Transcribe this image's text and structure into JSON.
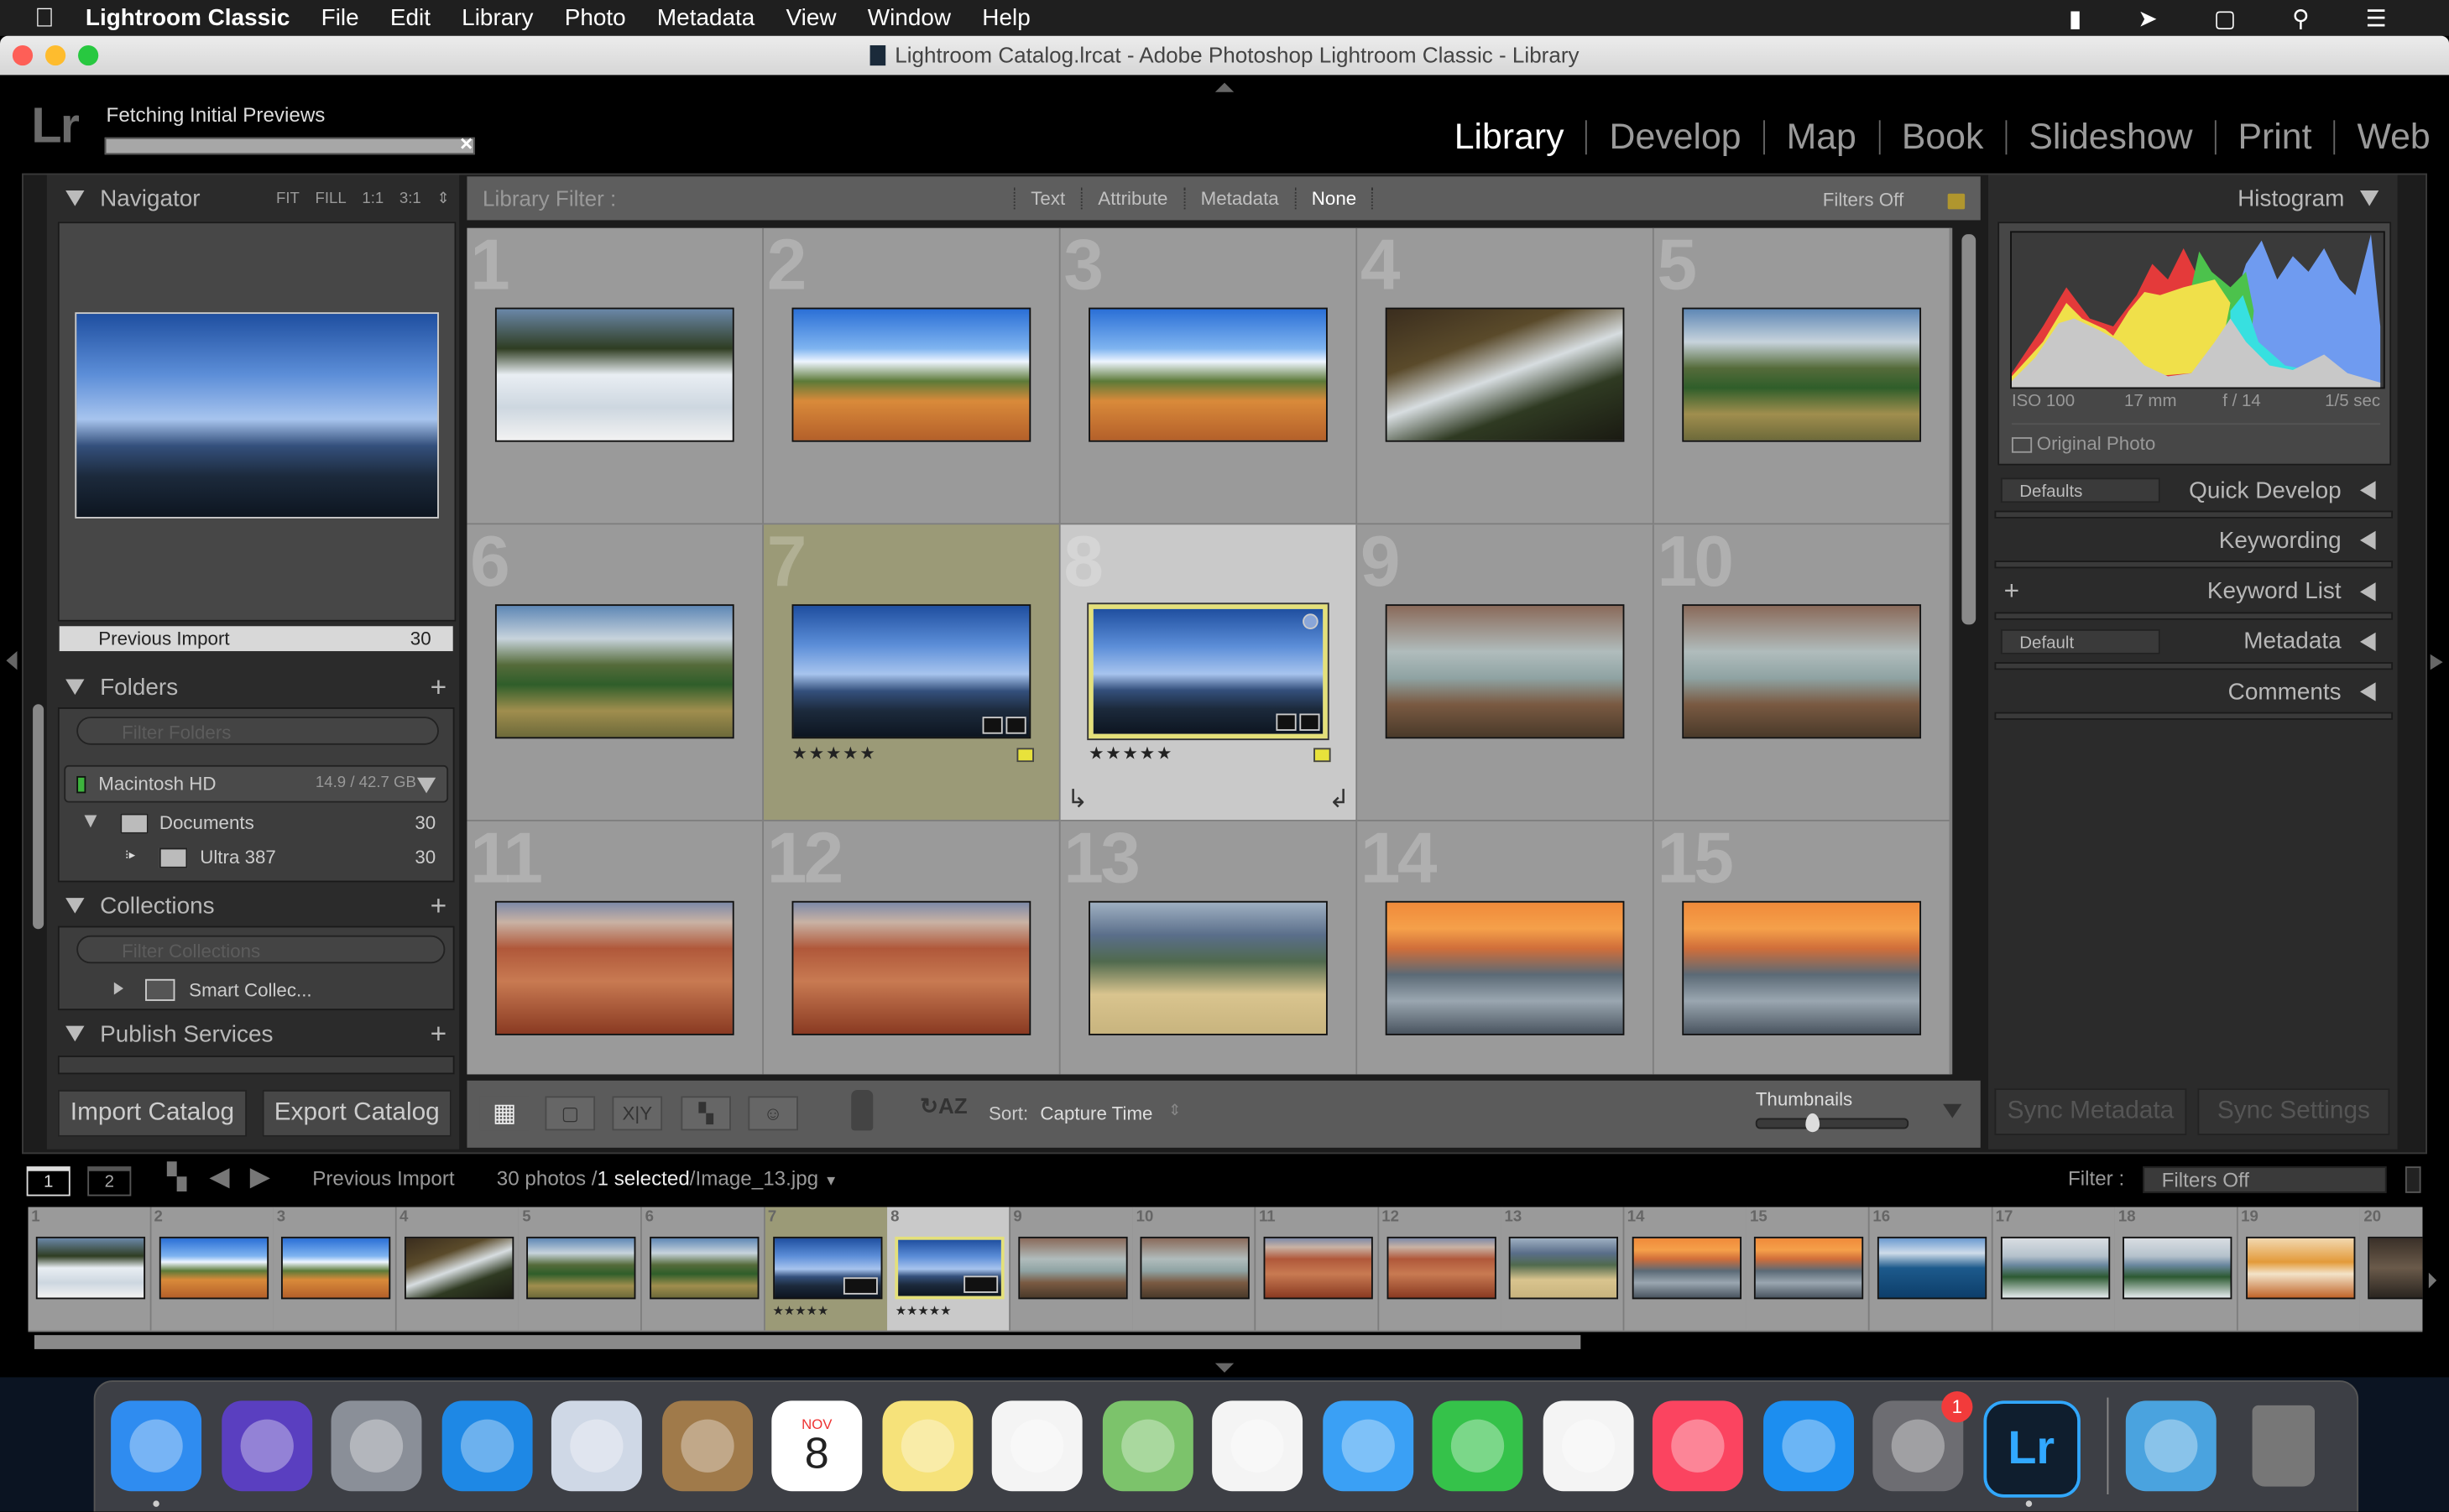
{
  "menubar": {
    "app": "Lightroom Classic",
    "items": [
      "File",
      "Edit",
      "Library",
      "Photo",
      "Metadata",
      "View",
      "Window",
      "Help"
    ]
  },
  "window": {
    "title": "Lightroom Catalog.lrcat - Adobe Photoshop Lightroom Classic - Library"
  },
  "identity": {
    "logo": "Lr",
    "status": "Fetching Initial Previews",
    "progress": 0.0
  },
  "modules": [
    {
      "label": "Library",
      "active": true
    },
    {
      "label": "Develop"
    },
    {
      "label": "Map"
    },
    {
      "label": "Book"
    },
    {
      "label": "Slideshow"
    },
    {
      "label": "Print"
    },
    {
      "label": "Web"
    }
  ],
  "navigator": {
    "title": "Navigator",
    "zoom_options": [
      "FIT",
      "FILL",
      "1:1",
      "3:1"
    ]
  },
  "catalog": {
    "item": "Previous Import",
    "count": "30"
  },
  "folders": {
    "title": "Folders",
    "filter_placeholder": "Filter Folders",
    "volume": {
      "name": "Macintosh HD",
      "usage": "14.9 / 42.7 GB"
    },
    "items": [
      {
        "name": "Documents",
        "count": "30"
      },
      {
        "name": "Ultra 387",
        "count": "30"
      }
    ]
  },
  "collections": {
    "title": "Collections",
    "filter_placeholder": "Filter Collections",
    "items": [
      "Smart Collec..."
    ]
  },
  "publish": {
    "title": "Publish Services"
  },
  "left_buttons": {
    "import": "Import Catalog",
    "export": "Export Catalog"
  },
  "filter_bar": {
    "label": "Library Filter :",
    "options": [
      "Text",
      "Attribute",
      "Metadata",
      "None"
    ],
    "active": "None",
    "filters_state": "Filters Off"
  },
  "grid": [
    {
      "n": "1",
      "theme": "snow"
    },
    {
      "n": "2",
      "theme": "desert"
    },
    {
      "n": "3",
      "theme": "desert"
    },
    {
      "n": "4",
      "theme": "falls"
    },
    {
      "n": "5",
      "theme": "canyon"
    },
    {
      "n": "6",
      "theme": "canyon"
    },
    {
      "n": "7",
      "theme": "sea",
      "state": "highlighted",
      "stars": "★★★★★"
    },
    {
      "n": "8",
      "theme": "sea",
      "state": "selected",
      "stars": "★★★★★"
    },
    {
      "n": "9",
      "theme": "lake"
    },
    {
      "n": "10",
      "theme": "lake"
    },
    {
      "n": "11",
      "theme": "hoodoo"
    },
    {
      "n": "12",
      "theme": "hoodoo"
    },
    {
      "n": "13",
      "theme": "valley"
    },
    {
      "n": "14",
      "theme": "dome"
    },
    {
      "n": "15",
      "theme": "dome"
    }
  ],
  "toolbar": {
    "sort_label": "Sort:",
    "sort_value": "Capture Time",
    "thumbnails_label": "Thumbnails",
    "thumbnail_size": 0.35
  },
  "histogram": {
    "title": "Histogram",
    "iso": "ISO 100",
    "focal": "17 mm",
    "aperture": "f / 14",
    "shutter": "1/5 sec",
    "original_photo": "Original Photo"
  },
  "right_panels": [
    {
      "label": "Quick Develop",
      "preset": "Defaults"
    },
    {
      "label": "Keywording"
    },
    {
      "label": "Keyword List",
      "plus": "+"
    },
    {
      "label": "Metadata",
      "preset": "Default"
    },
    {
      "label": "Comments"
    }
  ],
  "sync": {
    "metadata": "Sync Metadata",
    "settings": "Sync Settings"
  },
  "filmstrip_bar": {
    "screen1": "1",
    "screen2": "2",
    "source": "Previous Import",
    "count": "30 photos /",
    "selected": "1 selected",
    "file": "/Image_13.jpg",
    "filter_label": "Filter :",
    "filter_value": "Filters Off"
  },
  "filmstrip": [
    {
      "n": "1",
      "theme": "snow"
    },
    {
      "n": "2",
      "theme": "desert"
    },
    {
      "n": "3",
      "theme": "desert"
    },
    {
      "n": "4",
      "theme": "falls"
    },
    {
      "n": "5",
      "theme": "canyon"
    },
    {
      "n": "6",
      "theme": "canyon"
    },
    {
      "n": "7",
      "theme": "sea",
      "state": "highlighted",
      "stars": "★★★★★"
    },
    {
      "n": "8",
      "theme": "sea",
      "state": "selected",
      "stars": "★★★★★"
    },
    {
      "n": "9",
      "theme": "lake"
    },
    {
      "n": "10",
      "theme": "lake"
    },
    {
      "n": "11",
      "theme": "hoodoo"
    },
    {
      "n": "12",
      "theme": "hoodoo"
    },
    {
      "n": "13",
      "theme": "valley"
    },
    {
      "n": "14",
      "theme": "dome"
    },
    {
      "n": "15",
      "theme": "dome"
    },
    {
      "n": "16",
      "theme": "bluelake"
    },
    {
      "n": "17",
      "theme": "mountain"
    },
    {
      "n": "18",
      "theme": "mountain"
    },
    {
      "n": "19",
      "theme": "spa"
    },
    {
      "n": "20",
      "theme": "dark"
    }
  ],
  "dock": [
    {
      "name": "finder",
      "color": "#2f8cf0"
    },
    {
      "name": "siri",
      "color": "#5a3fc0"
    },
    {
      "name": "launchpad",
      "color": "#8a8f98"
    },
    {
      "name": "safari",
      "color": "#1e88e5"
    },
    {
      "name": "mail",
      "color": "#cfd8e6"
    },
    {
      "name": "contacts",
      "color": "#a07a4a"
    },
    {
      "name": "calendar",
      "color": "#ffffff",
      "month": "NOV",
      "day": "8"
    },
    {
      "name": "notes",
      "color": "#f6e27a"
    },
    {
      "name": "reminders",
      "color": "#f4f4f4"
    },
    {
      "name": "maps",
      "color": "#7cc36b"
    },
    {
      "name": "photos",
      "color": "#f4f4f4"
    },
    {
      "name": "messages",
      "color": "#3aa0f5"
    },
    {
      "name": "facetime",
      "color": "#35c24a"
    },
    {
      "name": "news",
      "color": "#f4f4f4"
    },
    {
      "name": "music",
      "color": "#fb4460"
    },
    {
      "name": "app-store",
      "color": "#1c8ef0"
    },
    {
      "name": "system-preferences",
      "color": "#6d6d72",
      "badge": "1"
    },
    {
      "name": "lightroom",
      "color": "#0f1e2e",
      "label": "Lr"
    },
    {
      "name": "downloads",
      "color": "#4aa3df"
    },
    {
      "name": "trash",
      "color": "#8a8a8a"
    }
  ],
  "colors": {
    "accent_flag": "#e8e23b",
    "selected_cell": "#c9c9c9",
    "highlight_cell": "#9b9a77",
    "panel": "#2b2b2b"
  }
}
